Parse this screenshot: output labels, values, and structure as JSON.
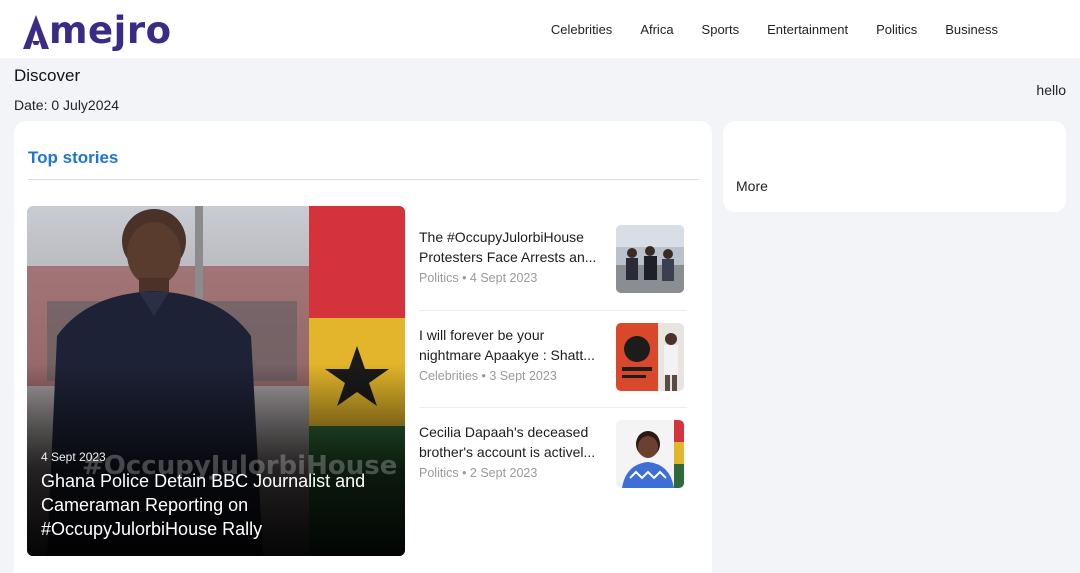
{
  "header": {
    "logo_text": "mejro",
    "nav": [
      "Celebrities",
      "Africa",
      "Sports",
      "Entertainment",
      "Politics",
      "Business"
    ]
  },
  "page": {
    "title": "Discover",
    "date": "Date: 0 July2024",
    "greeting": "hello"
  },
  "top_stories": {
    "heading": "Top stories",
    "featured": {
      "date": "4 Sept 2023",
      "title": "Ghana Police Detain BBC Journalist and Cameraman Reporting on #OccupyJulorbiHouse Rally",
      "image_caption": "#OccupyJulorbiHouse"
    },
    "items": [
      {
        "line1": "The #OccupyJulorbiHouse",
        "line2": "Protesters Face Arrests an...",
        "meta": "Politics • 4 Sept 2023"
      },
      {
        "line1": "I will forever be your",
        "line2": "nightmare Apaakye : Shatt...",
        "meta": "Celebrities • 3 Sept 2023"
      },
      {
        "line1": "Cecilia Dapaah's deceased",
        "line2": "brother's account is activel...",
        "meta": "Politics • 2 Sept 2023"
      }
    ]
  },
  "sidebar": {
    "more_label": "More"
  },
  "colors": {
    "brand": "#3b2a86",
    "accent": "#1f74d8",
    "background": "#f3f4f8"
  }
}
